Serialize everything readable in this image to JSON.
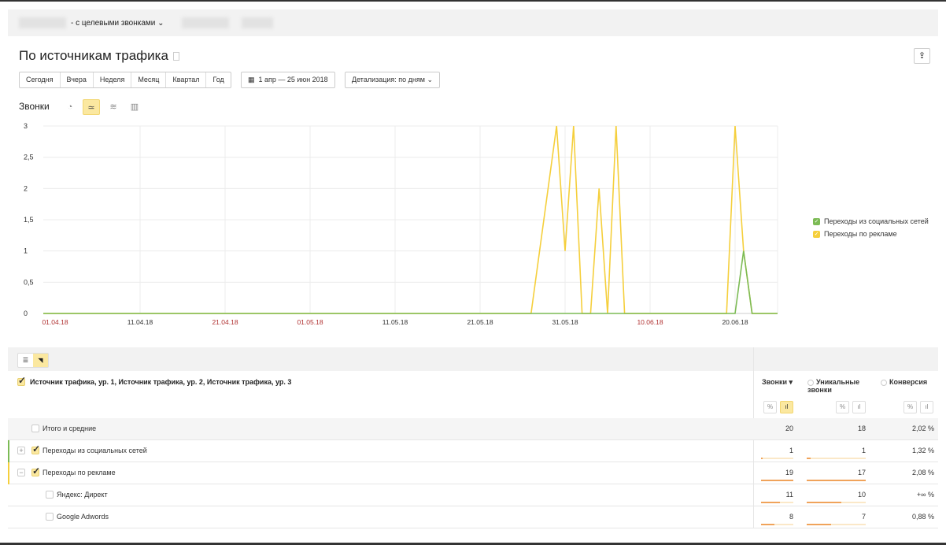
{
  "breadcrumb": {
    "goal_label": "- с целевыми звонками"
  },
  "page": {
    "title": "По источникам трафика"
  },
  "periods": [
    "Сегодня",
    "Вчера",
    "Неделя",
    "Месяц",
    "Квартал",
    "Год"
  ],
  "date_range": "1 апр — 25 июн 2018",
  "detail": "Детализация: по дням",
  "chart_title": "Звонки",
  "view_icons": [
    "pie-chart-icon",
    "line-chart-icon",
    "stacked-area-icon",
    "bar-chart-icon"
  ],
  "active_view": "line-chart-icon",
  "chart_data": {
    "type": "line",
    "ylim": [
      0,
      3
    ],
    "yticks": [
      "0",
      "0,5",
      "1",
      "1,5",
      "2",
      "2,5",
      "3"
    ],
    "ytick_values": [
      0,
      0.5,
      1,
      1.5,
      2,
      2.5,
      3
    ],
    "x_start": "01.04.18",
    "x_end": "25.06.18",
    "xticks": [
      {
        "label": "01.04.18",
        "weekend": true
      },
      {
        "label": "11.04.18",
        "weekend": false
      },
      {
        "label": "21.04.18",
        "weekend": true
      },
      {
        "label": "01.05.18",
        "weekend": true
      },
      {
        "label": "11.05.18",
        "weekend": false
      },
      {
        "label": "21.05.18",
        "weekend": false
      },
      {
        "label": "31.05.18",
        "weekend": false
      },
      {
        "label": "10.06.18",
        "weekend": true
      },
      {
        "label": "20.06.18",
        "weekend": false
      }
    ],
    "grid": true,
    "legend_position": "right",
    "series": [
      {
        "name": "Переходы из социальных сетей",
        "color": "#7cbb55",
        "values": [
          0,
          0,
          0,
          0,
          0,
          0,
          0,
          0,
          0,
          0,
          0,
          0,
          0,
          0,
          0,
          0,
          0,
          0,
          0,
          0,
          0,
          0,
          0,
          0,
          0,
          0,
          0,
          0,
          0,
          0,
          0,
          0,
          0,
          0,
          0,
          0,
          0,
          0,
          0,
          0,
          0,
          0,
          0,
          0,
          0,
          0,
          0,
          0,
          0,
          0,
          0,
          0,
          0,
          0,
          0,
          0,
          0,
          0,
          0,
          0,
          0,
          0,
          0,
          0,
          0,
          0,
          0,
          0,
          0,
          0,
          0,
          0,
          0,
          0,
          0,
          0,
          0,
          0,
          0,
          0,
          0,
          1,
          0,
          0,
          0,
          0
        ]
      },
      {
        "name": "Переходы по рекламе",
        "color": "#f5cf3c",
        "values": [
          0,
          0,
          0,
          0,
          0,
          0,
          0,
          0,
          0,
          0,
          0,
          0,
          0,
          0,
          0,
          0,
          0,
          0,
          0,
          0,
          0,
          0,
          0,
          0,
          0,
          0,
          0,
          0,
          0,
          0,
          0,
          0,
          0,
          0,
          0,
          0,
          0,
          0,
          0,
          0,
          0,
          0,
          0,
          0,
          0,
          0,
          0,
          0,
          0,
          0,
          0,
          0,
          0,
          0,
          0,
          0,
          0,
          1,
          2,
          3,
          1,
          3,
          0,
          0,
          2,
          0,
          3,
          0,
          0,
          0,
          0,
          0,
          0,
          0,
          0,
          0,
          0,
          0,
          0,
          0,
          3,
          1,
          0,
          0,
          0,
          0
        ]
      }
    ]
  },
  "table": {
    "dimensions": "Источник трафика, ур. 1, Источник трафика, ур. 2, Источник трафика, ур. 3",
    "columns": [
      "Звонки ▾",
      "Уникальные звонки",
      "Конверсия"
    ],
    "pct_label": "%",
    "rows": [
      {
        "label": "Итого и средние",
        "calls": "20",
        "unique": "18",
        "conv": "2,02 %",
        "checked": false,
        "level": 0,
        "type": "total"
      },
      {
        "label": "Переходы из социальных сетей",
        "calls": "1",
        "unique": "1",
        "conv": "1,32 %",
        "checked": true,
        "level": 0,
        "toggle": "+",
        "accent": "#7cbb55",
        "calls_frac": 0.05,
        "unique_frac": 0.06
      },
      {
        "label": "Переходы по рекламе",
        "calls": "19",
        "unique": "17",
        "conv": "2,08 %",
        "checked": true,
        "level": 0,
        "toggle": "−",
        "accent": "#f5cf3c",
        "calls_frac": 1,
        "unique_frac": 1
      },
      {
        "label": "Яндекс: Директ",
        "calls": "11",
        "unique": "10",
        "conv": "+∞ %",
        "checked": false,
        "level": 1,
        "calls_frac": 0.58,
        "unique_frac": 0.59
      },
      {
        "label": "Google Adwords",
        "calls": "8",
        "unique": "7",
        "conv": "0,88 %",
        "checked": false,
        "level": 1,
        "calls_frac": 0.42,
        "unique_frac": 0.41
      }
    ]
  }
}
